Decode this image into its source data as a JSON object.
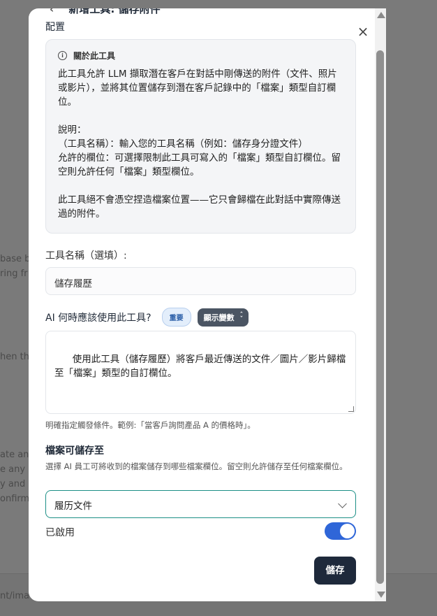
{
  "background": {
    "fragments": [
      "base b",
      "ring fr",
      "hen th",
      "ate an",
      "e any",
      "y and",
      "onfirm",
      "nt/ima"
    ]
  },
  "modal": {
    "title": "新增工具: 儲存附件",
    "section_label": "配置",
    "info": {
      "title": "關於此工具",
      "body": "此工具允許 LLM 擷取潛在客戶在對話中剛傳送的附件（文件、照片或影片），並將其位置儲存到潛在客戶記錄中的「檔案」類型自訂欄位。\n\n說明：\n（工具名稱）：輸入您的工具名稱（例如：儲存身分證文件）\n允許的欄位：可選擇限制此工具可寫入的「檔案」類型自訂欄位。留空則允許任何「檔案」類型欄位。\n\n此工具絕不會憑空捏造檔案位置——它只會歸檔在此對話中實際傳送過的附件。"
    },
    "tool_name": {
      "label": "工具名稱（選填）:",
      "value": "儲存履歷"
    },
    "when_to_use": {
      "label": "AI 何時應該使用此工具?",
      "badge_important": "重要",
      "badge_vars": "顯示變數",
      "value": "使用此工具（儲存履歷）將客戶最近傳送的文件／圖片／影片歸檔至「檔案」類型的自訂欄位。",
      "hint": "明確指定觸發條件。範例:「當客戶詢問產品 A 的價格時」。"
    },
    "storage": {
      "title": "檔案可儲存至",
      "description": "選擇 AI 員工可將收到的檔案儲存到哪些檔案欄位。留空則允許儲存至任何檔案欄位。",
      "selected": "履历文件"
    },
    "enabled": {
      "label": "已啟用",
      "state": true
    },
    "save_label": "儲存"
  },
  "colors": {
    "accent": "#2f66d8",
    "primary_button": "#1e293b",
    "select_border": "#1c8f86"
  }
}
